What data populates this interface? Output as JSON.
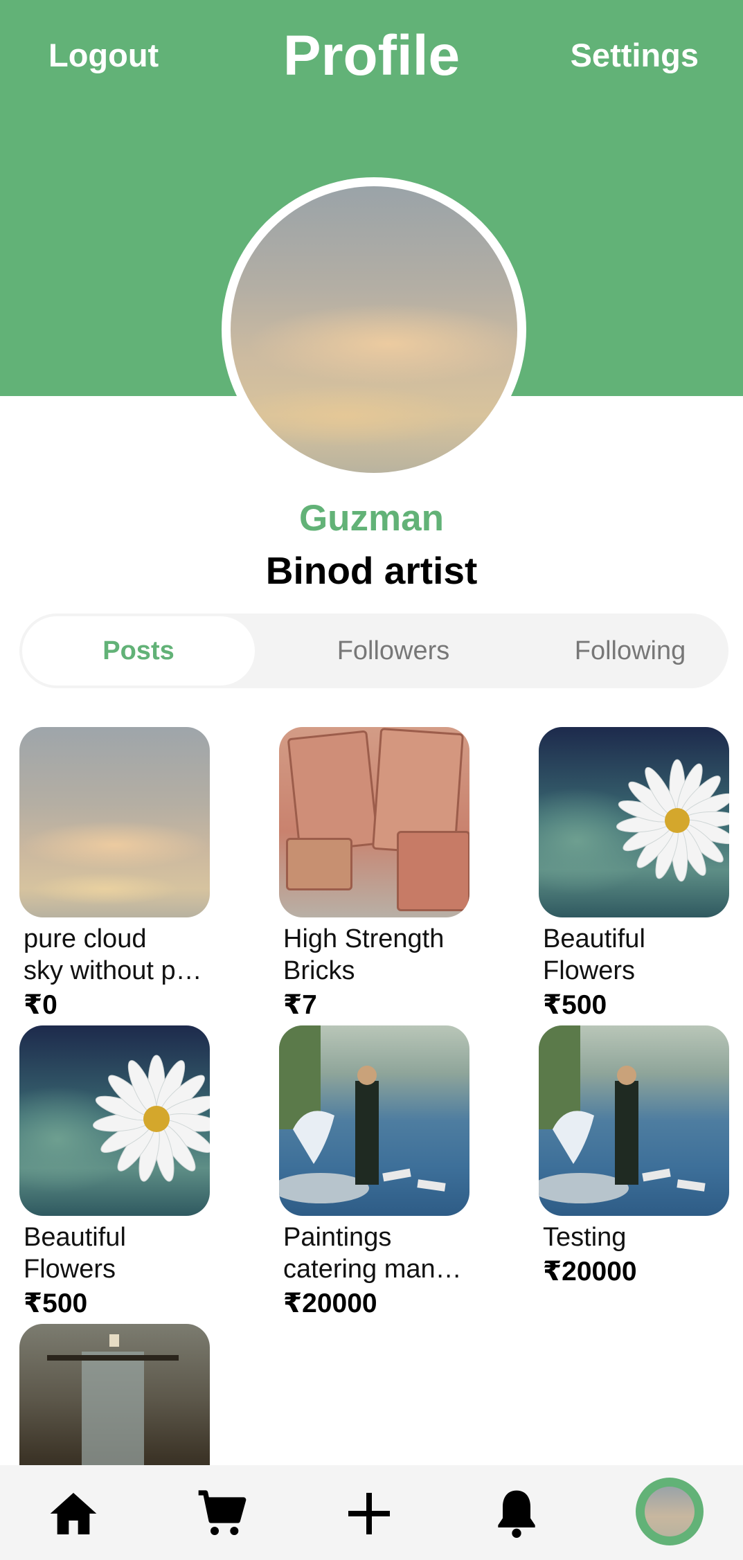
{
  "header": {
    "logout_label": "Logout",
    "title": "Profile",
    "settings_label": "Settings",
    "accent_color": "#62b277"
  },
  "profile": {
    "name": "Guzman",
    "tagline": "Binod artist"
  },
  "tabs": [
    {
      "label": "Posts",
      "active": true
    },
    {
      "label": "Followers",
      "active": false
    },
    {
      "label": "Following",
      "active": false
    }
  ],
  "posts": [
    {
      "title": "pure cloud\n sky without p…",
      "price": "₹0",
      "image": "cloud-sky"
    },
    {
      "title": "High Strength\nBricks",
      "price": "₹7",
      "image": "bricks"
    },
    {
      "title": "Beautiful\nFlowers",
      "price": "₹500",
      "image": "daisy-flower"
    },
    {
      "title": "Beautiful\nFlowers",
      "price": "₹500",
      "image": "daisy-flower"
    },
    {
      "title": "Paintings\ncatering man…",
      "price": "₹20000",
      "image": "swan-painting"
    },
    {
      "title": "Testing",
      "price": "₹20000",
      "image": "swan-painting"
    },
    {
      "title": "",
      "price": "",
      "image": "dark-painting"
    }
  ],
  "bottom_nav": {
    "items": [
      "home-icon",
      "cart-icon",
      "add-icon",
      "bell-icon",
      "profile-avatar"
    ]
  }
}
